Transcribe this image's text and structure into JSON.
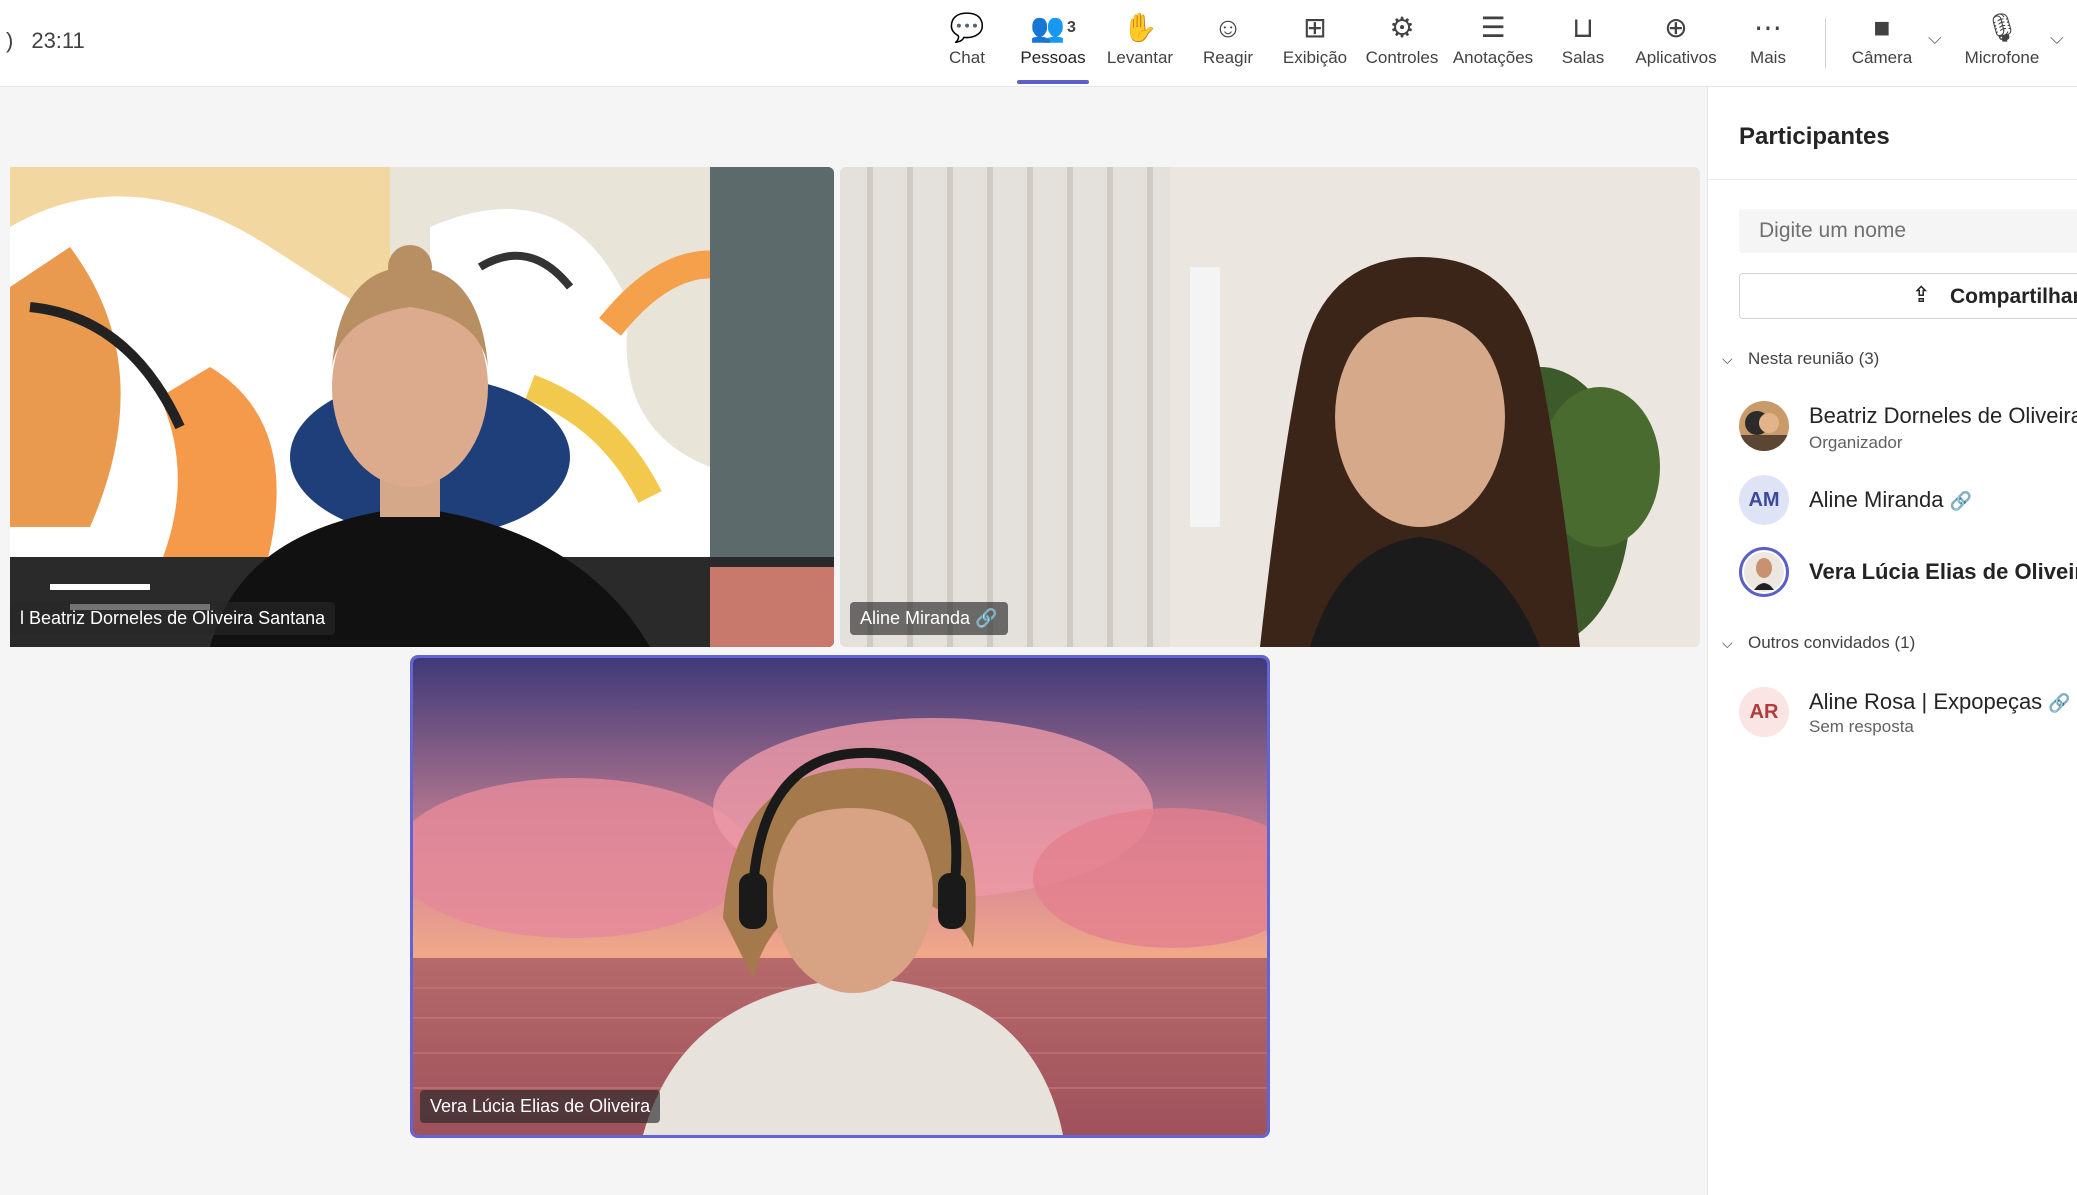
{
  "clock": {
    "paren": ")",
    "time": "23:11"
  },
  "toolbar": {
    "chat": {
      "label": "Chat",
      "icon": "chat-icon",
      "glyph": "💬"
    },
    "people": {
      "label": "Pessoas",
      "icon": "people-icon",
      "glyph": "👥",
      "count": "3"
    },
    "raise": {
      "label": "Levantar",
      "icon": "raise-hand-icon",
      "glyph": "✋"
    },
    "react": {
      "label": "Reagir",
      "icon": "smile-icon",
      "glyph": "☺"
    },
    "view": {
      "label": "Exibição",
      "icon": "grid-view-icon",
      "glyph": "⊞"
    },
    "controls": {
      "label": "Controles",
      "icon": "controls-icon",
      "glyph": "⚙"
    },
    "notes": {
      "label": "Anotações",
      "icon": "notes-icon",
      "glyph": "☰"
    },
    "rooms": {
      "label": "Salas",
      "icon": "rooms-icon",
      "glyph": "⊔"
    },
    "apps": {
      "label": "Aplicativos",
      "icon": "add-app-icon",
      "glyph": "⊕"
    },
    "more": {
      "label": "Mais",
      "icon": "more-icon",
      "glyph": "⋯"
    },
    "camera": {
      "label": "Câmera",
      "icon": "camera-icon",
      "glyph": "■"
    },
    "mic": {
      "label": "Microfone",
      "icon": "microphone-icon",
      "glyph": "🎙"
    },
    "chevron": "⌵",
    "active_color": "#5b5fc7"
  },
  "tiles": [
    {
      "name": "Beatriz Dorneles de Oliveira Santana",
      "prefix": "l"
    },
    {
      "name": "Aline Miranda",
      "device_icon": "phone-device-icon",
      "device_glyph": "🔗"
    },
    {
      "name": "Vera Lúcia Elias de Oliveira"
    }
  ],
  "panel": {
    "title": "Participantes",
    "search_placeholder": "Digite um nome",
    "share_label": "Compartilhar",
    "share_glyph": "⇪",
    "in_meeting": "Nesta reunião (3)",
    "others": "Outros convidados (1)",
    "caret": "⌵",
    "participants": [
      {
        "name": "Beatriz Dorneles de Oliveira",
        "sub": "Organizador"
      },
      {
        "initials": "AM",
        "name": "Aline Miranda",
        "device_glyph": "🔗"
      },
      {
        "name": "Vera Lúcia Elias de Oliveira"
      }
    ],
    "invited": [
      {
        "initials": "AR",
        "name": "Aline Rosa | Expopeças",
        "device_glyph": "🔗",
        "sub": "Sem resposta"
      }
    ]
  }
}
